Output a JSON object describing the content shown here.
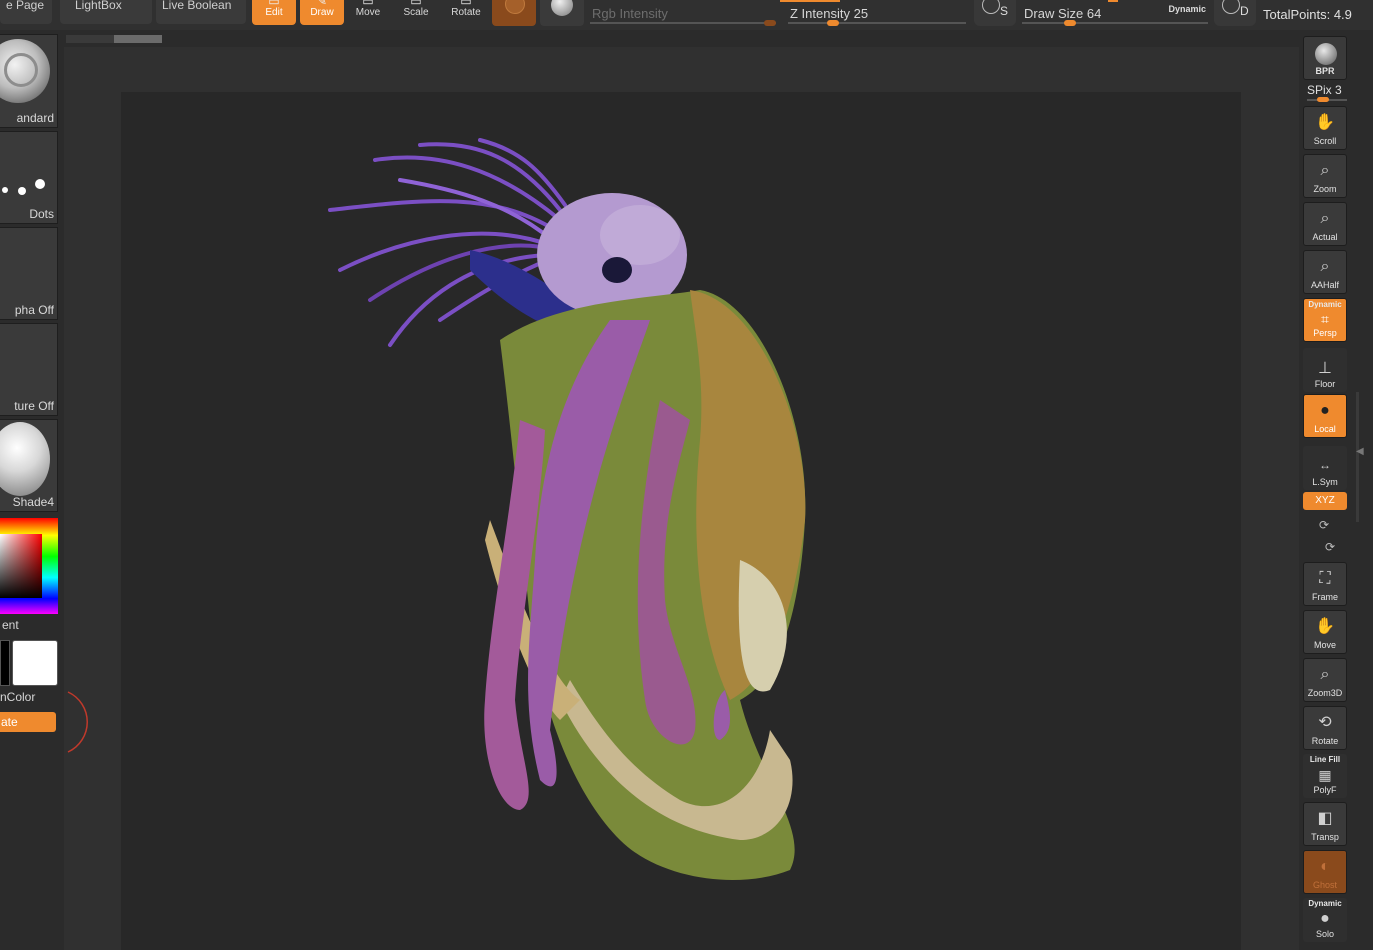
{
  "toolbar": {
    "home_page": "e Page",
    "lightbox": "LightBox",
    "live_boolean": "Live Boolean",
    "edit": "Edit",
    "draw": "Draw",
    "move": "Move",
    "scale": "Scale",
    "rotate": "Rotate",
    "rgb_intensity_label": "Rgb Intensity",
    "z_intensity_label": "Z Intensity",
    "z_intensity_value": "25",
    "s_button": "S",
    "draw_size_label": "Draw Size",
    "draw_size_value": "64",
    "dynamic_label": "Dynamic",
    "d_button": "D",
    "total_points": "TotalPoints: 4.9"
  },
  "left_shelf": {
    "brush_label": "andard",
    "stroke_label": "Dots",
    "alpha_label": "pha Off",
    "texture_label": "ture Off",
    "material_label": "Shade4",
    "gradient_label": "ent",
    "switch_color_label": "nColor",
    "alternate_label": "ate"
  },
  "right_shelf": {
    "bpr": "BPR",
    "spix_label": "SPix",
    "spix_value": "3",
    "scroll": "Scroll",
    "zoom": "Zoom",
    "actual": "Actual",
    "aahalf": "AAHalf",
    "persp_tag": "Dynamic",
    "persp": "Persp",
    "floor": "Floor",
    "local": "Local",
    "lsym": "L.Sym",
    "xyz": "XYZ",
    "frame": "Frame",
    "move": "Move",
    "zoom3d": "Zoom3D",
    "rotate": "Rotate",
    "polyf_tag": "Line Fill",
    "polyf": "PolyF",
    "transp": "Transp",
    "ghost": "Ghost",
    "solo_tag": "Dynamic",
    "solo": "Solo"
  },
  "colors": {
    "accent": "#ef8a2e",
    "panel": "#3a3a3a",
    "canvas": "#303030",
    "document": "#282828"
  },
  "sliders": {
    "rgb_intensity": 0.97,
    "z_intensity": 0.25,
    "draw_size": 0.26,
    "spix": 0.4
  }
}
